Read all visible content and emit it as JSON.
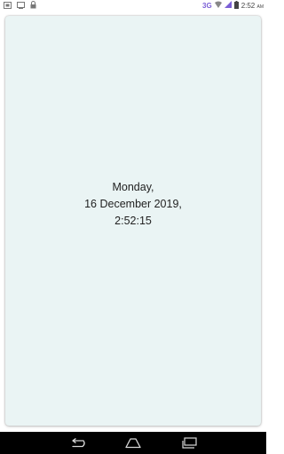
{
  "status_bar": {
    "network": "3G",
    "time": "2:52",
    "ampm": "AM",
    "icons": [
      "notification-icon",
      "screenshot-icon",
      "lock-icon",
      "wifi-icon",
      "signal-icon",
      "battery-icon"
    ]
  },
  "clock": {
    "day": "Monday,",
    "date": "16 December 2019,",
    "time": "2:52:15"
  },
  "nav_bar": {
    "icons": [
      "back-icon",
      "home-icon",
      "recents-icon"
    ]
  }
}
